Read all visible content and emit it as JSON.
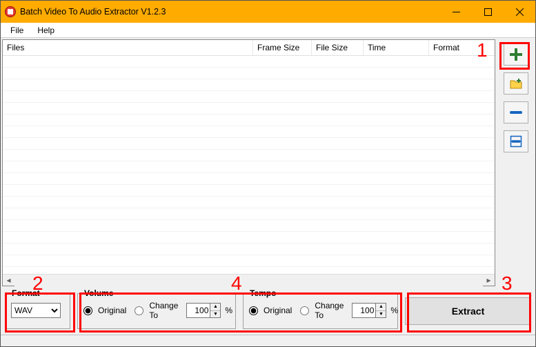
{
  "window": {
    "title": "Batch Video To Audio Extractor V1.2.3",
    "min_label": "Minimize",
    "max_label": "Maximize",
    "close_label": "Close"
  },
  "menu": {
    "file": "File",
    "help": "Help"
  },
  "list": {
    "columns": {
      "files": "Files",
      "frame": "Frame Size",
      "size": "File Size",
      "time": "Time",
      "format": "Format"
    },
    "rows": []
  },
  "side": {
    "add_file": "Add File",
    "add_folder": "Add Folder",
    "remove": "Remove",
    "remove_all": "Remove All"
  },
  "settings": {
    "format": {
      "legend": "Format",
      "selected": "WAV",
      "options": [
        "WAV"
      ]
    },
    "volume": {
      "legend": "Volume",
      "original": "Original",
      "changeto": "Change To",
      "value": "100",
      "pct": "%",
      "selected": "original"
    },
    "tempo": {
      "legend": "Tempo",
      "original": "Original",
      "changeto": "Change To",
      "value": "100",
      "pct": "%",
      "selected": "original"
    }
  },
  "action": {
    "extract": "Extract"
  },
  "annotations": {
    "1": "1",
    "2": "2",
    "3": "3",
    "4": "4"
  }
}
